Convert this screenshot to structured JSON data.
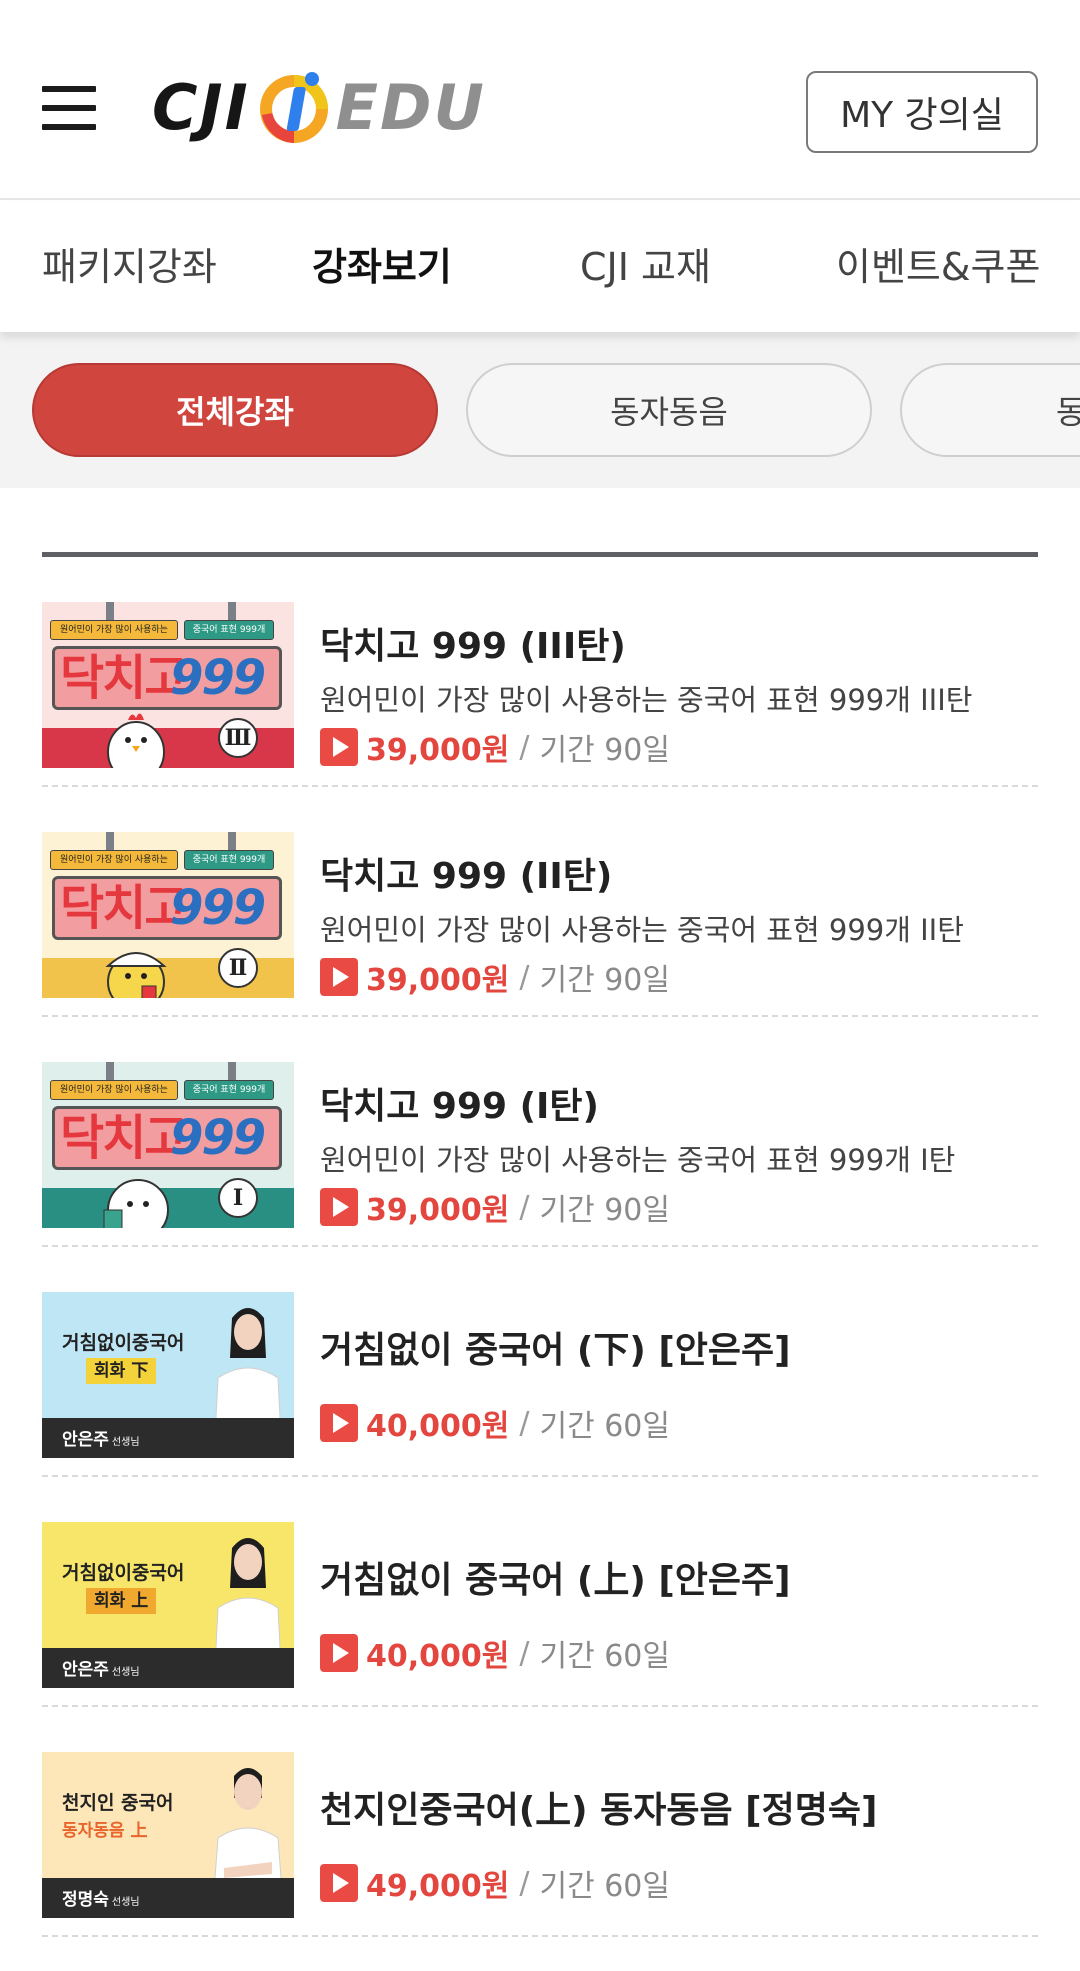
{
  "header": {
    "menu_icon": "hamburger-menu-icon",
    "logo": {
      "left": "CJI",
      "right": "EDU",
      "mark_colors": [
        "#f5a623",
        "#e8453c",
        "#2f80ed"
      ]
    },
    "my_button": "MY 강의실"
  },
  "nav": {
    "tabs": [
      {
        "label": "패키지강좌",
        "active": false
      },
      {
        "label": "강좌보기",
        "active": true
      },
      {
        "label": "CJI 교재",
        "active": false
      },
      {
        "label": "이벤트&쿠폰",
        "active": false
      }
    ]
  },
  "chips": {
    "items": [
      {
        "label": "전체강좌",
        "active": true
      },
      {
        "label": "동자동음",
        "active": false
      },
      {
        "label": "동",
        "active": false
      }
    ]
  },
  "colors": {
    "accent": "#d1453f",
    "price": "#e2463f"
  },
  "courses": [
    {
      "title": "닥치고 999 (III탄)",
      "subtitle": "원어민이 가장 많이 사용하는 중국어 표현 999개 III탄",
      "price": "39,000원",
      "separator": "/",
      "period": "기간 90일",
      "thumb": {
        "tag1": "원어민이 가장 많이 사용하는",
        "tag2": "중국어 표현 999개",
        "word": "닥치고",
        "num": "999",
        "roman": "Ⅲ",
        "bottom_color": "#d8374a",
        "top_color": "#fbe3e1"
      }
    },
    {
      "title": "닥치고 999 (II탄)",
      "subtitle": "원어민이 가장 많이 사용하는 중국어 표현 999개 II탄",
      "price": "39,000원",
      "separator": "/",
      "period": "기간 90일",
      "thumb": {
        "tag1": "원어민이 가장 많이 사용하는",
        "tag2": "중국어 표현 999개",
        "word": "닥치고",
        "num": "999",
        "roman": "Ⅱ",
        "bottom_color": "#f2c34a",
        "top_color": "#fdf3d4"
      }
    },
    {
      "title": "닥치고 999 (I탄)",
      "subtitle": "원어민이 가장 많이 사용하는 중국어 표현 999개 I탄",
      "price": "39,000원",
      "separator": "/",
      "period": "기간 90일",
      "thumb": {
        "tag1": "원어민이 가장 많이 사용하는",
        "tag2": "중국어 표현 999개",
        "word": "닥치고",
        "num": "999",
        "roman": "Ⅰ",
        "bottom_color": "#2a8f83",
        "top_color": "#dff0ec"
      }
    },
    {
      "title": "거침없이 중국어 (下) [안은주]",
      "price": "40,000원",
      "separator": "/",
      "period": "기간 60일",
      "thumb": {
        "line1": "거침없이중국어",
        "line2": "회화 下",
        "teacher": "안은주",
        "teacher_suffix": "선생님",
        "bg": "#bfe6f4",
        "badge_bg": "#f3d23a",
        "badge_color": "#222"
      }
    },
    {
      "title": "거침없이 중국어 (上) [안은주]",
      "price": "40,000원",
      "separator": "/",
      "period": "기간 60일",
      "thumb": {
        "line1": "거침없이중국어",
        "line2": "회화 上",
        "teacher": "안은주",
        "teacher_suffix": "선생님",
        "bg": "#f8e66a",
        "badge_bg": "#f0a92e",
        "badge_color": "#222"
      }
    },
    {
      "title": "천지인중국어(上) 동자동음 [정명숙]",
      "price": "49,000원",
      "separator": "/",
      "period": "기간 60일",
      "thumb": {
        "line1": "천지인 중국어",
        "line2": "동자동음 上",
        "teacher": "정명숙",
        "teacher_suffix": "선생님",
        "bg": "#fde6b8",
        "badge_bg": "transparent",
        "badge_color": "#e8642b"
      }
    }
  ]
}
